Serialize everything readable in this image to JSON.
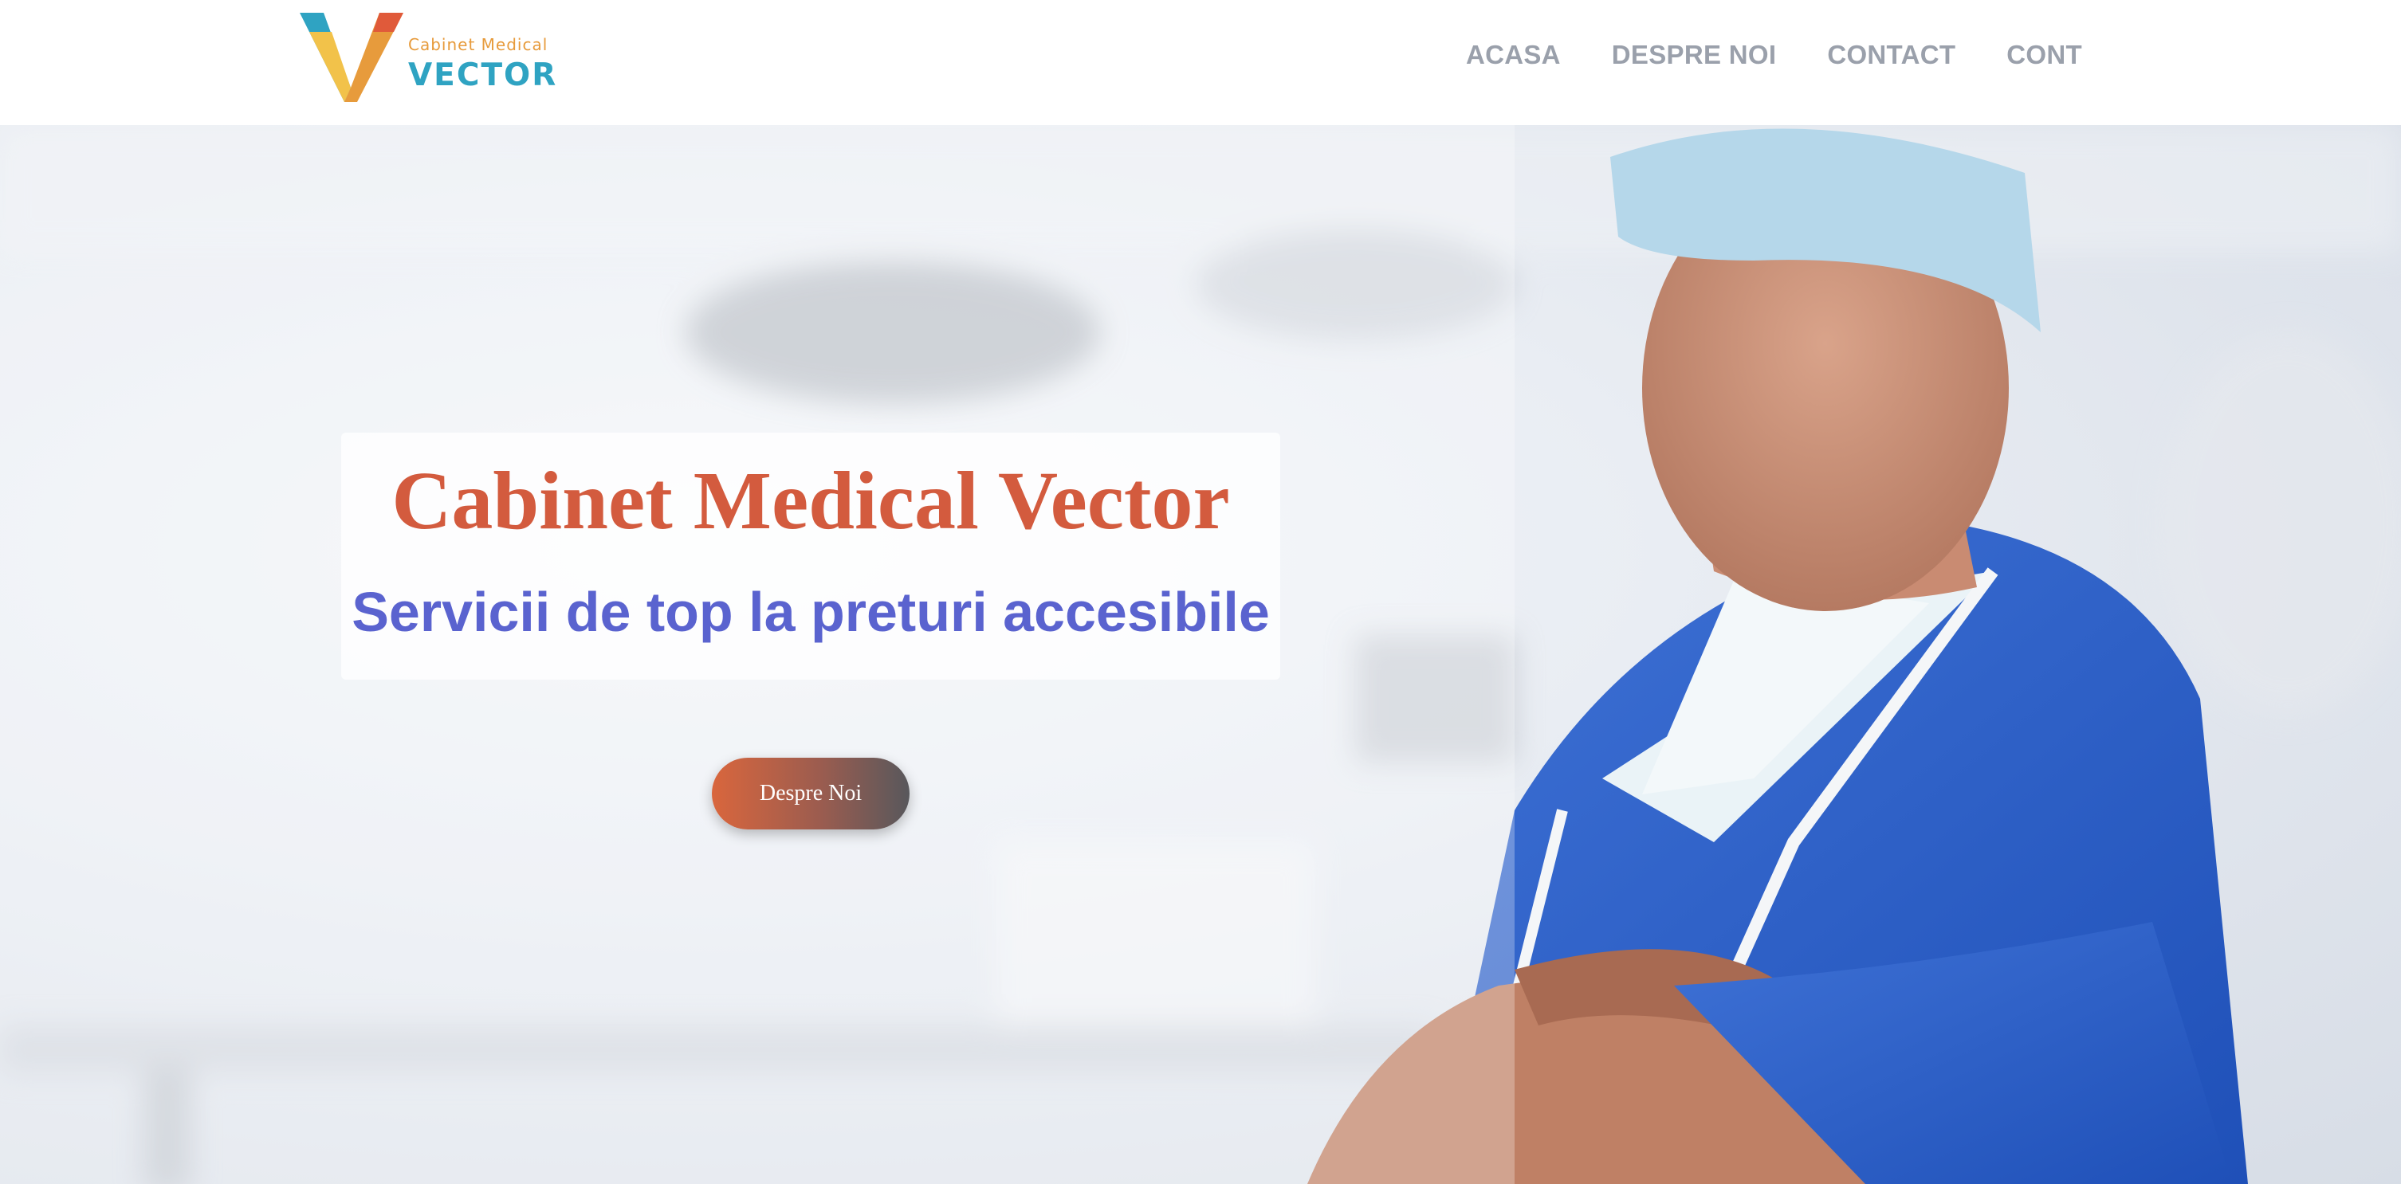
{
  "brand": {
    "tagline": "Cabinet Medical",
    "name": "VECTOR",
    "colors": {
      "orange": "#e79b3c",
      "teal": "#2fa3c2",
      "red": "#e05a3a",
      "yellow": "#f2c24a"
    }
  },
  "nav": {
    "items": [
      {
        "label": "ACASA"
      },
      {
        "label": "DESPRE NOI"
      },
      {
        "label": "CONTACT"
      },
      {
        "label": "CONT"
      }
    ]
  },
  "hero": {
    "title": "Cabinet Medical Vector",
    "subtitle": "Servicii de top la preturi accesibile",
    "button_label": "Despre Noi",
    "title_color": "#d35b3e",
    "subtitle_color": "#5a63cf",
    "image_subject": "doctor-in-blue-scrubs-photo"
  }
}
